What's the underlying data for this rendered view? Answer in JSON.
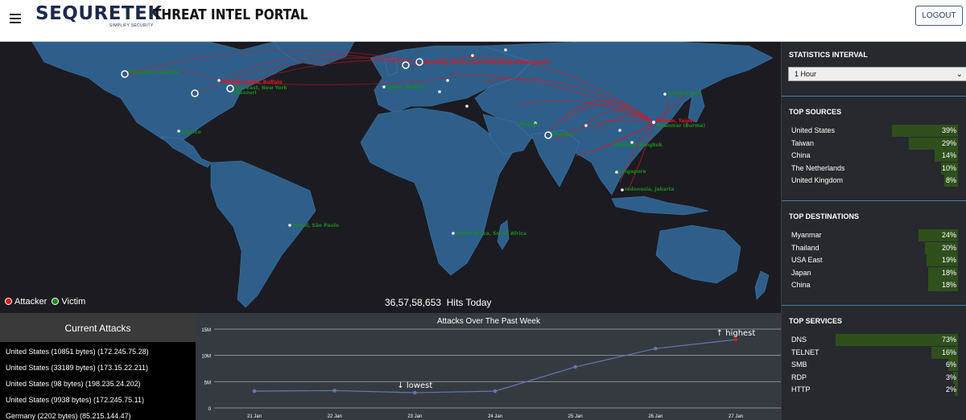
{
  "header": {
    "logo": "SEQURETEK",
    "logo_sub": "SIMPLIFY SECURITY",
    "portal_title": "THREAT INTEL PORTAL",
    "logout_label": "LOGOUT"
  },
  "map": {
    "legend": {
      "attacker": "Attacker",
      "victim": "Victim"
    },
    "hits_count": "36,57,58,653",
    "hits_label": "Hits Today",
    "colors": {
      "attacker": "#e0141e",
      "victim": "#1a8a1a",
      "land": "#2d5f8a",
      "ocean": "#1c1b22"
    },
    "labels": [
      {
        "text": "USA West, Seattle",
        "color": "#1a8a1a"
      },
      {
        "text": "United States, Buffalo",
        "color": "#e0141e"
      },
      {
        "text": "USA East, New York",
        "color": "#1a8a1a"
      },
      {
        "text": "Missouri",
        "color": "#1a8a1a"
      },
      {
        "text": "Mexico",
        "color": "#1a8a1a"
      },
      {
        "text": "Brazil, São Paulo",
        "color": "#1a8a1a"
      },
      {
        "text": "South Africa, South Africa",
        "color": "#1a8a1a"
      },
      {
        "text": "Germany, Berlin (Charlottenburg-Wilmersdorf)",
        "color": "#e0141e"
      },
      {
        "text": "Spain, Madrid",
        "color": "#1a8a1a"
      },
      {
        "text": "Mumbai",
        "color": "#1a8a1a"
      },
      {
        "text": "Muscat",
        "color": "#1a8a1a"
      },
      {
        "text": "Taiwan, Taipei",
        "color": "#e0141e"
      },
      {
        "text": "Myanmar (Burma)",
        "color": "#1a8a1a"
      },
      {
        "text": "Thailand, Bangkok",
        "color": "#1a8a1a"
      },
      {
        "text": "South Korea",
        "color": "#1a8a1a"
      },
      {
        "text": "Singapore",
        "color": "#1a8a1a"
      },
      {
        "text": "Indonesia, Jakarta",
        "color": "#1a8a1a"
      }
    ]
  },
  "current_attacks": {
    "title": "Current Attacks",
    "rows": [
      "United States (10851 bytes) (172.245.75.28)",
      "United States (33189 bytes) (173.15.22.211)",
      "United States (98 bytes) (198.235.24.202)",
      "United States (9938 bytes) (172.245.75.11)",
      "Germany (2202 bytes) (85.215.144.47)"
    ]
  },
  "chart_data": {
    "type": "line",
    "title": "Attacks Over The Past Week",
    "categories": [
      "21 Jan",
      "22 Jan",
      "23 Jan",
      "24 Jan",
      "25 Jan",
      "26 Jan",
      "27 Jan"
    ],
    "values": [
      3200000,
      3300000,
      2900000,
      3200000,
      7800000,
      11300000,
      13000000
    ],
    "y_ticks": [
      "15M",
      "10M",
      "5M",
      "0"
    ],
    "ylim": [
      0,
      15000000
    ],
    "grid": true,
    "annotations": {
      "lowest": "↓ lowest",
      "highest": "↑ highest"
    },
    "line_color": "#6a74b0",
    "highlight_color": "#e0141e"
  },
  "sidebar": {
    "interval": {
      "title": "STATISTICS INTERVAL",
      "selected": "1 Hour"
    },
    "top_sources": {
      "title": "TOP SOURCES",
      "items": [
        {
          "name": "United States",
          "value": "39%",
          "pct": 39
        },
        {
          "name": "Taiwan",
          "value": "29%",
          "pct": 29
        },
        {
          "name": "China",
          "value": "14%",
          "pct": 14
        },
        {
          "name": "The Netherlands",
          "value": "10%",
          "pct": 10
        },
        {
          "name": "United Kingdom",
          "value": "8%",
          "pct": 8
        }
      ]
    },
    "top_destinations": {
      "title": "TOP DESTINATIONS",
      "items": [
        {
          "name": "Myanmar",
          "value": "24%",
          "pct": 24
        },
        {
          "name": "Thailand",
          "value": "20%",
          "pct": 20
        },
        {
          "name": "USA East",
          "value": "19%",
          "pct": 19
        },
        {
          "name": "Japan",
          "value": "18%",
          "pct": 18
        },
        {
          "name": "China",
          "value": "18%",
          "pct": 18
        }
      ]
    },
    "top_services": {
      "title": "TOP SERVICES",
      "items": [
        {
          "name": "DNS",
          "value": "73%",
          "pct": 73
        },
        {
          "name": "TELNET",
          "value": "16%",
          "pct": 16
        },
        {
          "name": "SMB",
          "value": "6%",
          "pct": 6
        },
        {
          "name": "RDP",
          "value": "3%",
          "pct": 3
        },
        {
          "name": "HTTP",
          "value": "2%",
          "pct": 2
        }
      ]
    }
  }
}
